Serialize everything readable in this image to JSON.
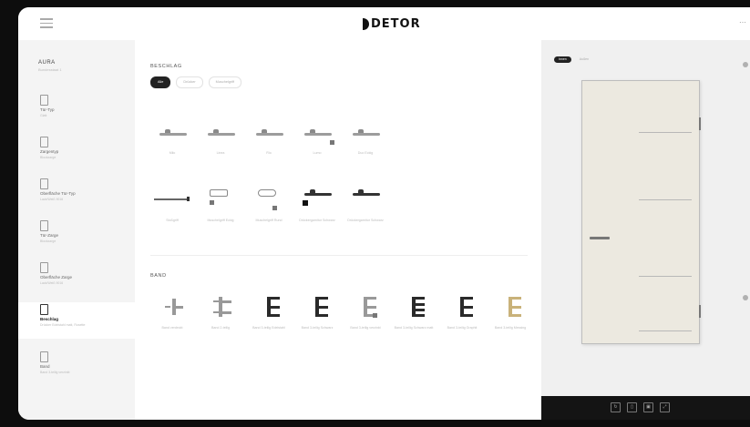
{
  "app": {
    "logo_text": "DETOR"
  },
  "sidebar": {
    "header": {
      "title": "AURA",
      "subtitle": "Bundesstaat 1"
    },
    "items": [
      {
        "label": "Tür-Typ",
        "sub": "Glatt",
        "active": false
      },
      {
        "label": "Zargentyp",
        "sub": "Blockzarge",
        "active": false
      },
      {
        "label": "Oberfläche Tür-Typ",
        "sub": "Lack/Weiß 9016",
        "active": false
      },
      {
        "label": "Tür-Zarge",
        "sub": "Blockzarge",
        "active": false
      },
      {
        "label": "Oberfläche Zarge",
        "sub": "Lack/Weiß 9016",
        "active": false
      },
      {
        "label": "Beschlag",
        "sub": "Drücker Edelstahl matt, Rosette",
        "active": true
      },
      {
        "label": "Band",
        "sub": "Band 3-teilig verzinkt",
        "active": false
      }
    ]
  },
  "main": {
    "beschlag": {
      "title": "BESCHLAG",
      "filters": [
        "Alle",
        "Drücker",
        "Muschelgriff"
      ],
      "tiles": [
        {
          "caption": "Milo",
          "style": "light"
        },
        {
          "caption": "Linea",
          "style": "light"
        },
        {
          "caption": "Rio",
          "style": "light"
        },
        {
          "caption": "Lumo",
          "style": "light"
        },
        {
          "caption": "Duo Eckig",
          "style": "light"
        },
        {
          "caption": "Stoßgriff",
          "style": "light"
        },
        {
          "caption": "Muschelgriff Eckig",
          "style": "light"
        },
        {
          "caption": "Muschelgriff Rund",
          "style": "light"
        },
        {
          "caption": "Drückergarnitur Schwarz",
          "style": "dark"
        },
        {
          "caption": "Drückergarnitur Schwarz",
          "style": "dark"
        }
      ]
    },
    "band": {
      "title": "BAND",
      "tiles": [
        {
          "caption": "Band verdeckt",
          "style": "light"
        },
        {
          "caption": "Band 2-teilig",
          "style": "light"
        },
        {
          "caption": "Band 3-teilig Edelstahl",
          "style": "dark"
        },
        {
          "caption": "Band 3-teilig Schwarz",
          "style": "dark"
        },
        {
          "caption": "Band 3-teilig verzinkt",
          "style": "light"
        },
        {
          "caption": "Band 3-teilig Schwarz matt",
          "style": "dark"
        },
        {
          "caption": "Band 3-teilig Graphit",
          "style": "dark"
        },
        {
          "caption": "Band 3-teilig Messing",
          "style": "gold"
        }
      ]
    }
  },
  "preview": {
    "view_toggle": [
      "Innen",
      "Außen"
    ],
    "door_color": "#ece9e0"
  },
  "toolbar": {
    "buttons": [
      {
        "icon": "rotate-icon",
        "glyph": "↻"
      },
      {
        "icon": "door-icon",
        "glyph": "▯"
      },
      {
        "icon": "image-icon",
        "glyph": "▣"
      },
      {
        "icon": "fullscreen-icon",
        "glyph": "⤢"
      }
    ]
  },
  "colors": {
    "accent": "#222222",
    "background": "#ffffff",
    "toolbar": "#141414",
    "frame": "#0d0d0d"
  }
}
